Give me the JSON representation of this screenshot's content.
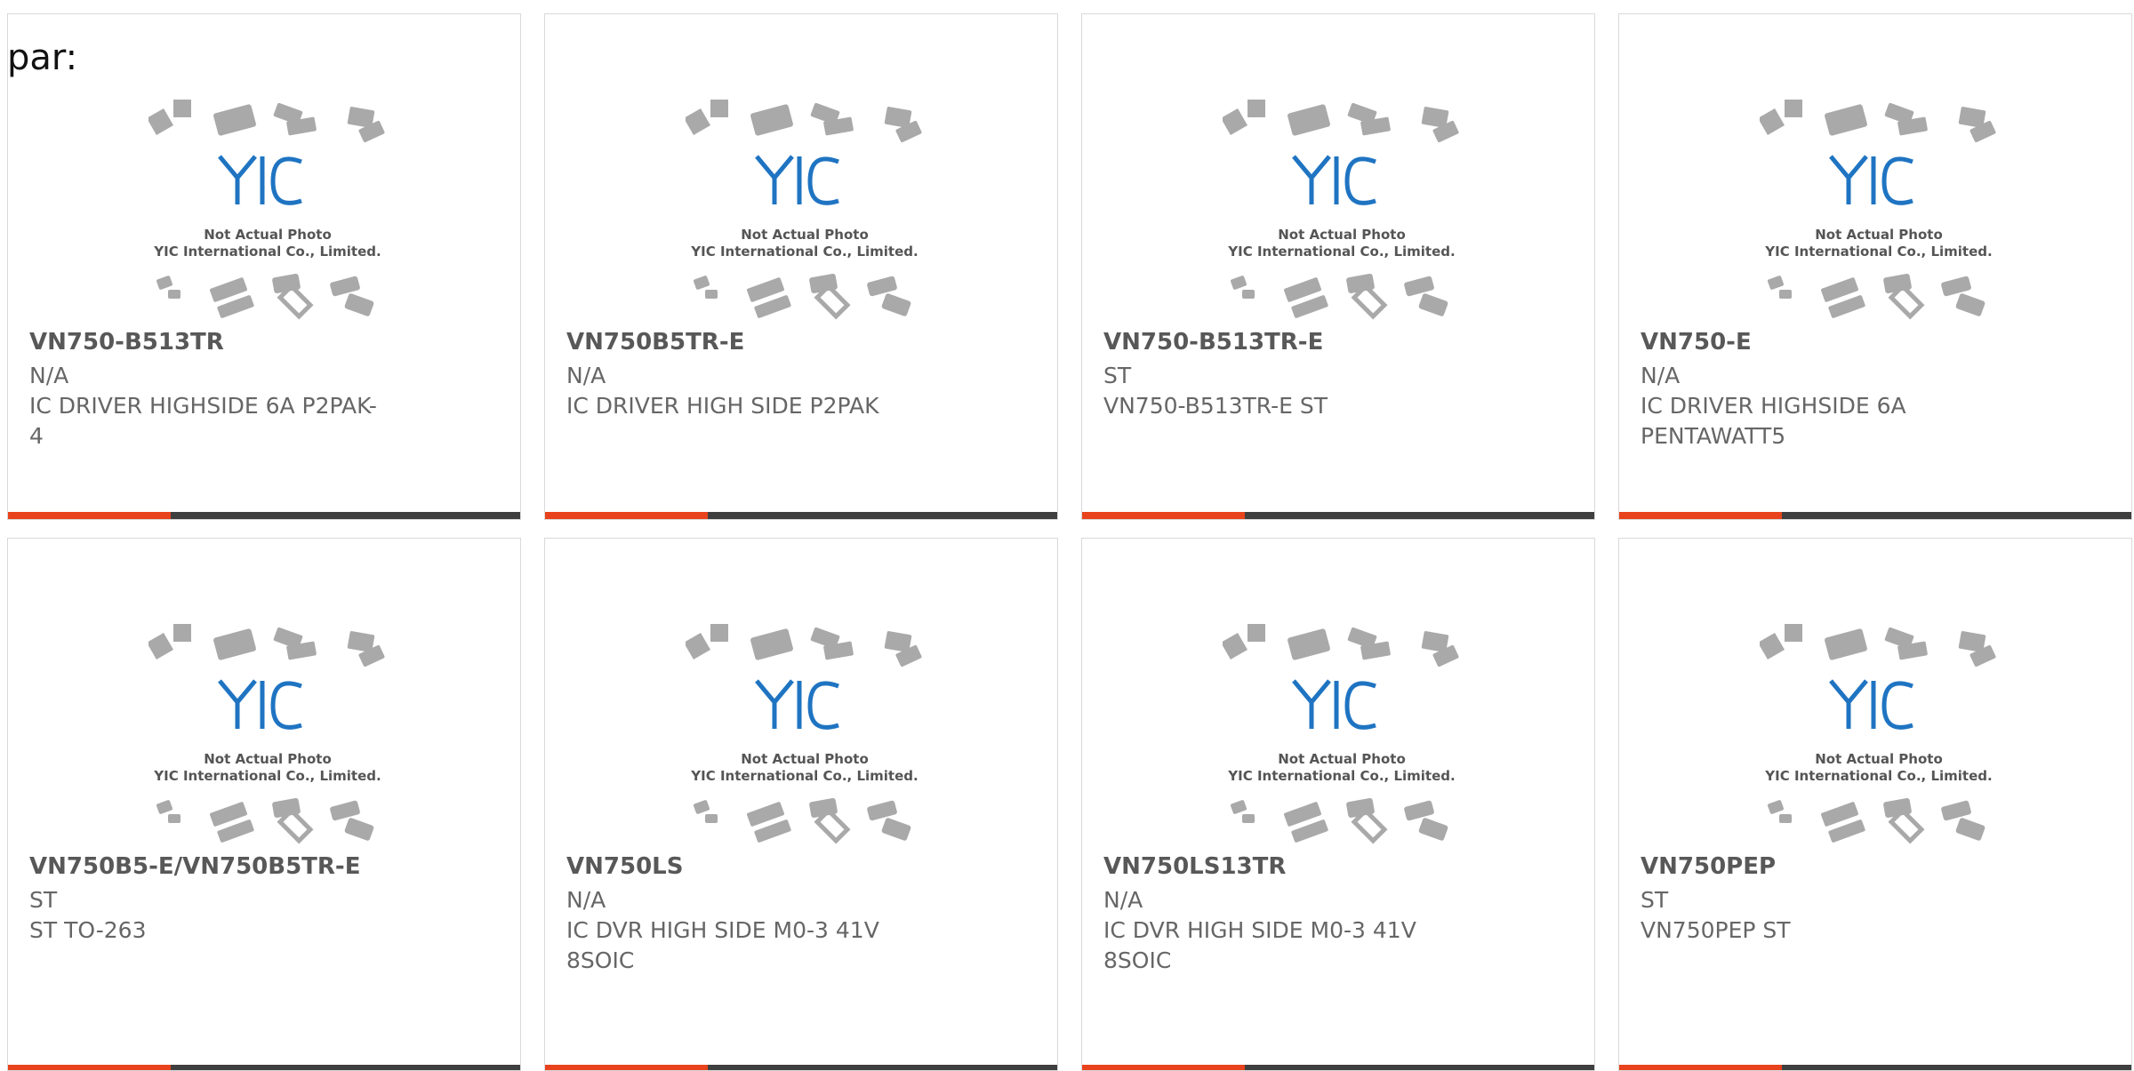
{
  "page": {
    "fragment_text": "par:"
  },
  "photo": {
    "logo_text": "YIC",
    "caption_line1": "Not Actual Photo",
    "caption_line2": "YIC International Co., Limited."
  },
  "colors": {
    "accent": "#e8431c",
    "bar": "#3f3f3f",
    "logo_blue": "#1f74c2",
    "chip_gray": "#a9a9a9"
  },
  "products": [
    {
      "part": "VN750-B513TR",
      "manufacturer": "N/A",
      "description_line1": "IC DRIVER HIGHSIDE 6A P2PAK-",
      "description_line2": "4"
    },
    {
      "part": "VN750B5TR-E",
      "manufacturer": "N/A",
      "description_line1": "IC DRIVER HIGH SIDE P2PAK",
      "description_line2": ""
    },
    {
      "part": "VN750-B513TR-E",
      "manufacturer": "ST",
      "description_line1": "VN750-B513TR-E ST",
      "description_line2": ""
    },
    {
      "part": "VN750-E",
      "manufacturer": "N/A",
      "description_line1": "IC DRIVER HIGHSIDE 6A",
      "description_line2": "PENTAWATT5"
    },
    {
      "part": "VN750B5-E/VN750B5TR-E",
      "manufacturer": "ST",
      "description_line1": "ST TO-263",
      "description_line2": ""
    },
    {
      "part": "VN750LS",
      "manufacturer": "N/A",
      "description_line1": "IC DVR HIGH SIDE M0-3 41V",
      "description_line2": "8SOIC"
    },
    {
      "part": "VN750LS13TR",
      "manufacturer": "N/A",
      "description_line1": "IC DVR HIGH SIDE M0-3 41V",
      "description_line2": "8SOIC"
    },
    {
      "part": "VN750PEP",
      "manufacturer": "ST",
      "description_line1": "VN750PEP ST",
      "description_line2": ""
    }
  ]
}
